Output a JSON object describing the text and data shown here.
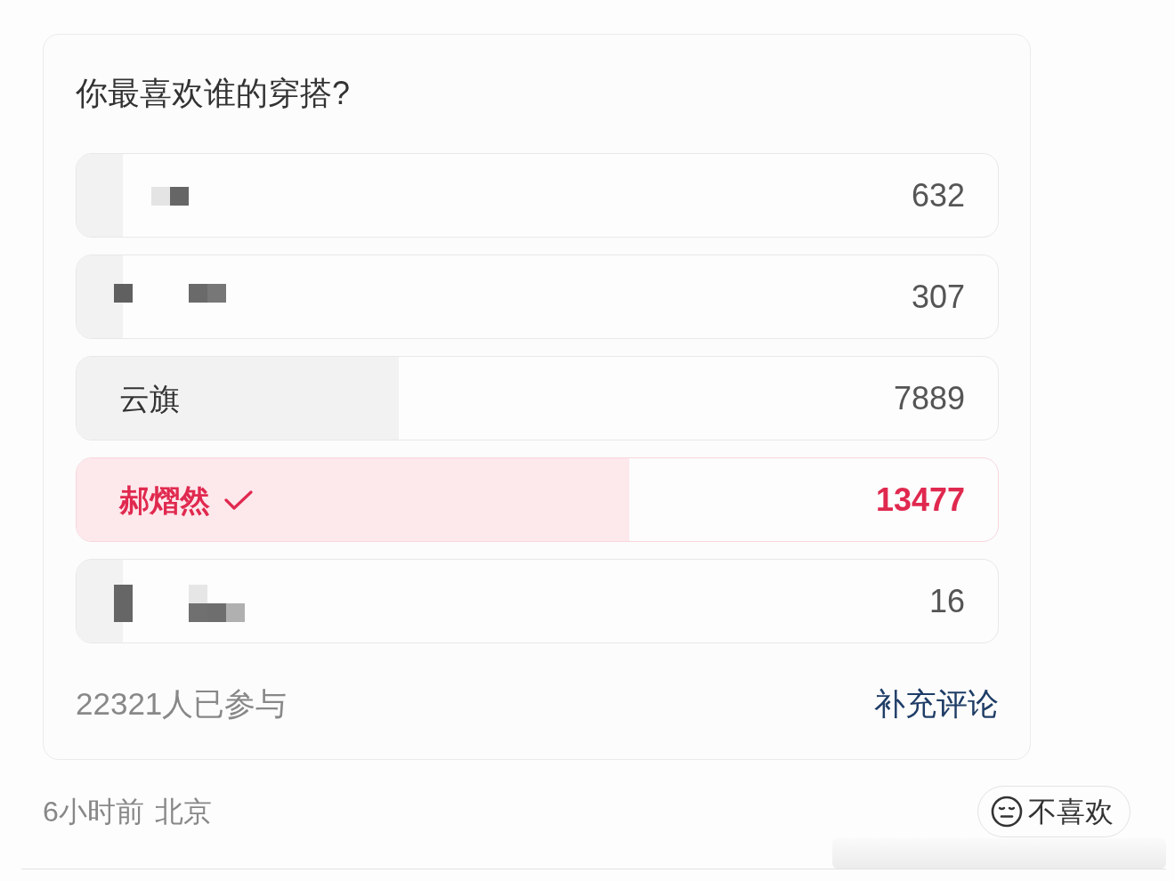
{
  "poll": {
    "question": "你最喜欢谁的穿搭?",
    "options": [
      {
        "kind": "redacted",
        "count": "632",
        "selected": false,
        "level": 0.05
      },
      {
        "kind": "redacted",
        "count": "307",
        "selected": false,
        "level": 0.05
      },
      {
        "kind": "text",
        "label": "云旗",
        "count": "7889",
        "selected": false,
        "level": 0.35
      },
      {
        "kind": "text",
        "label": "郝熠然",
        "count": "13477",
        "selected": true,
        "level": 0.6
      },
      {
        "kind": "redacted",
        "count": "16",
        "selected": false,
        "level": 0.05
      }
    ],
    "participants": "22321人已参与",
    "action": "补充评论"
  },
  "meta": {
    "time": "6小时前",
    "location": "北京"
  },
  "dislike_button": {
    "label": "不喜欢"
  }
}
